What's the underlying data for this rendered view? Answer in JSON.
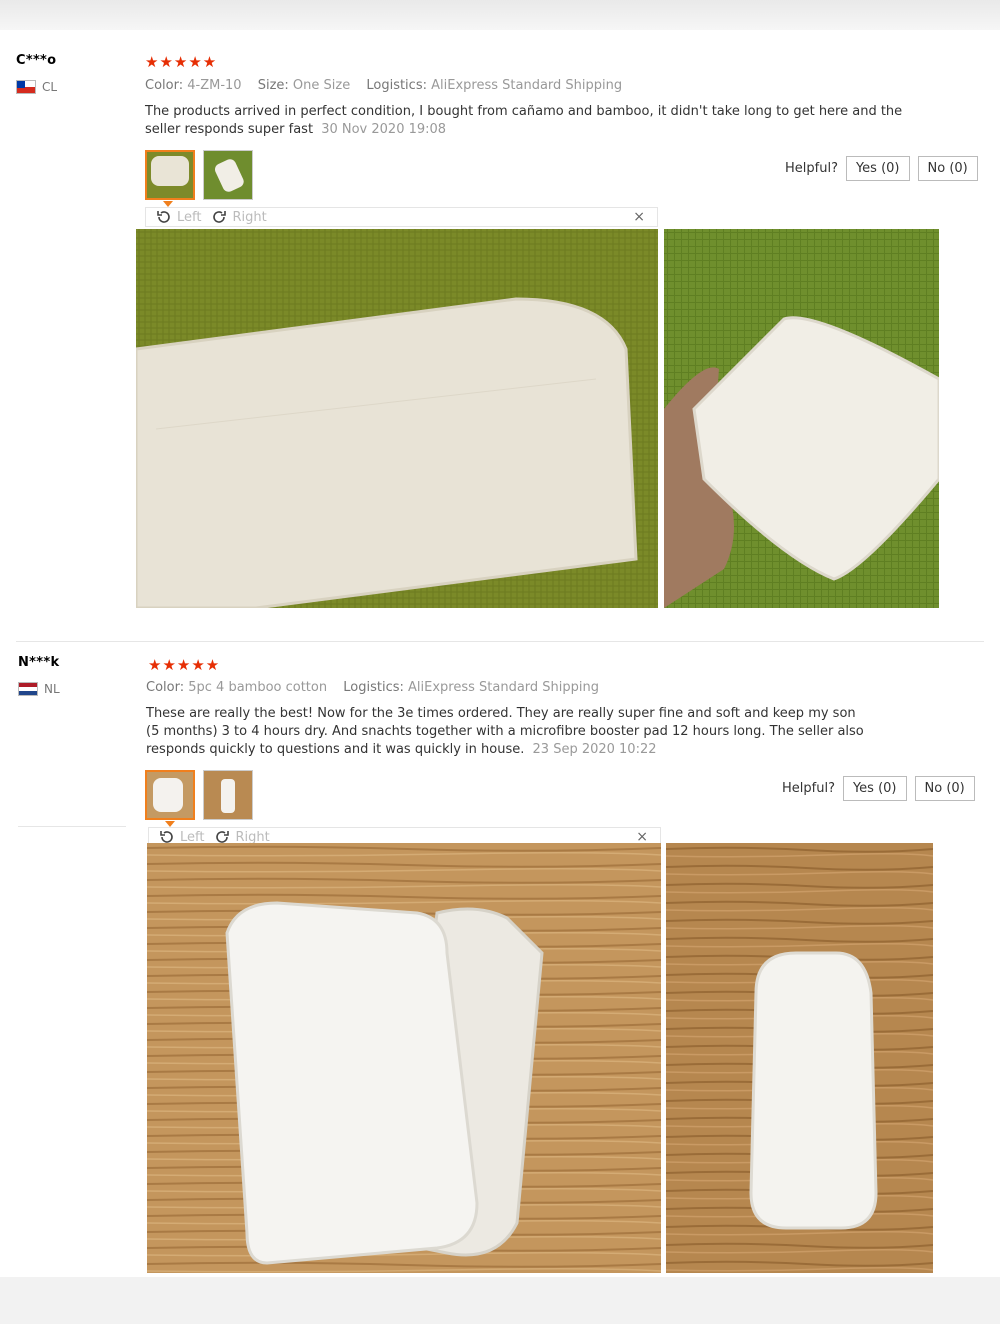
{
  "reviews": [
    {
      "user": "C***o",
      "country": "CL",
      "stars": "★★★★★",
      "color_label": "Color:",
      "color_value": "4-ZM-10",
      "size_label": "Size:",
      "size_value": "One Size",
      "logistics_label": "Logistics:",
      "logistics_value": "AliExpress Standard Shipping",
      "text": "The products arrived in perfect condition, I bought from cañamo and bamboo, it didn't take long to get here and the seller responds super fast",
      "date": "30 Nov 2020 19:08",
      "helpful": "Helpful?",
      "yes": "Yes (0)",
      "no": "No (0)",
      "rotate_left": "Left",
      "rotate_right": "Right",
      "close": "×"
    },
    {
      "user": "N***k",
      "country": "NL",
      "stars": "★★★★★",
      "color_label": "Color:",
      "color_value": "5pc 4 bamboo cotton",
      "logistics_label": "Logistics:",
      "logistics_value": "AliExpress Standard Shipping",
      "text": "These are really the best! Now for the 3e times ordered. They are really super fine and soft and keep my son (5 months) 3 to 4 hours dry. And snachts together with a microfibre booster pad 12 hours long. The seller also responds quickly to questions and it was quickly in house.",
      "date": "23 Sep 2020 10:22",
      "helpful": "Helpful?",
      "yes": "Yes (0)",
      "no": "No (0)",
      "rotate_left": "Left",
      "rotate_right": "Right",
      "close": "×"
    }
  ],
  "icons": {
    "star": "star-icon",
    "rotate_left": "rotate-left-icon",
    "rotate_right": "rotate-right-icon",
    "close": "close-icon"
  },
  "colors": {
    "star": "#e62e04",
    "active_thumb": "#f07f1d",
    "grass_green": "#7d8a2a",
    "wood": "#b98a52"
  }
}
